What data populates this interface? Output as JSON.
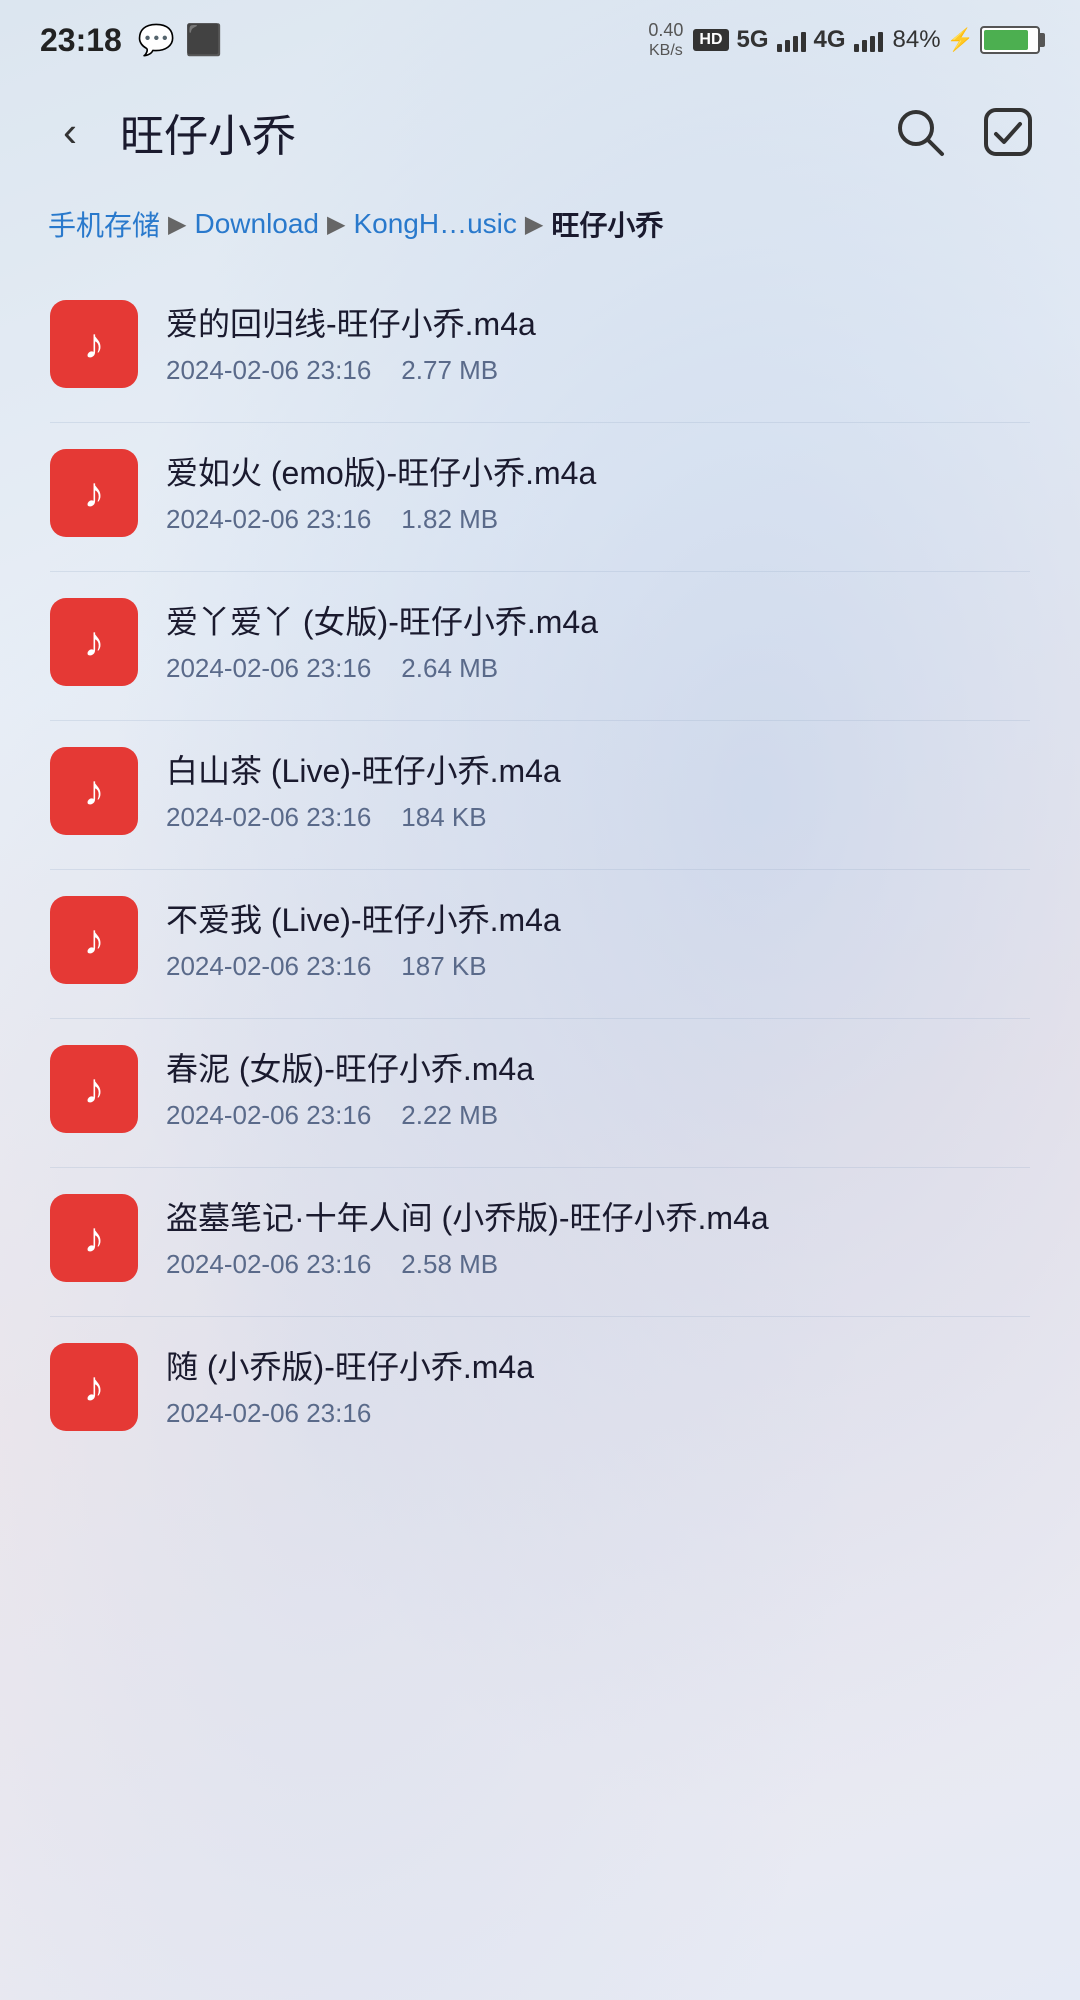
{
  "statusBar": {
    "time": "23:18",
    "networkSpeed": "0.40\nKB/s",
    "batteryPercent": "84%"
  },
  "header": {
    "title": "旺仔小乔",
    "backLabel": "‹",
    "searchLabel": "search",
    "checkboxLabel": "select"
  },
  "breadcrumb": {
    "items": [
      {
        "label": "手机存储",
        "type": "link"
      },
      {
        "label": "Download",
        "type": "link"
      },
      {
        "label": "KongH…usic",
        "type": "link"
      },
      {
        "label": "旺仔小乔",
        "type": "current"
      }
    ]
  },
  "files": [
    {
      "name": "爱的回归线-旺仔小乔.m4a",
      "date": "2024-02-06 23:16",
      "size": "2.77 MB"
    },
    {
      "name": "爱如火 (emo版)-旺仔小乔.m4a",
      "date": "2024-02-06 23:16",
      "size": "1.82 MB"
    },
    {
      "name": "爱丫爱丫 (女版)-旺仔小乔.m4a",
      "date": "2024-02-06 23:16",
      "size": "2.64 MB"
    },
    {
      "name": "白山茶 (Live)-旺仔小乔.m4a",
      "date": "2024-02-06 23:16",
      "size": "184 KB"
    },
    {
      "name": "不爱我 (Live)-旺仔小乔.m4a",
      "date": "2024-02-06 23:16",
      "size": "187 KB"
    },
    {
      "name": "春泥 (女版)-旺仔小乔.m4a",
      "date": "2024-02-06 23:16",
      "size": "2.22 MB"
    },
    {
      "name": "盗墓笔记·十年人间 (小乔版)-旺仔小乔.m4a",
      "date": "2024-02-06 23:16",
      "size": "2.58 MB"
    },
    {
      "name": "随 (小乔版)-旺仔小乔.m4a",
      "date": "2024-02-06 23:16",
      "size": ""
    }
  ],
  "icons": {
    "musicNote": "♪",
    "back": "‹",
    "search": "🔍",
    "checkbox": "☑"
  }
}
